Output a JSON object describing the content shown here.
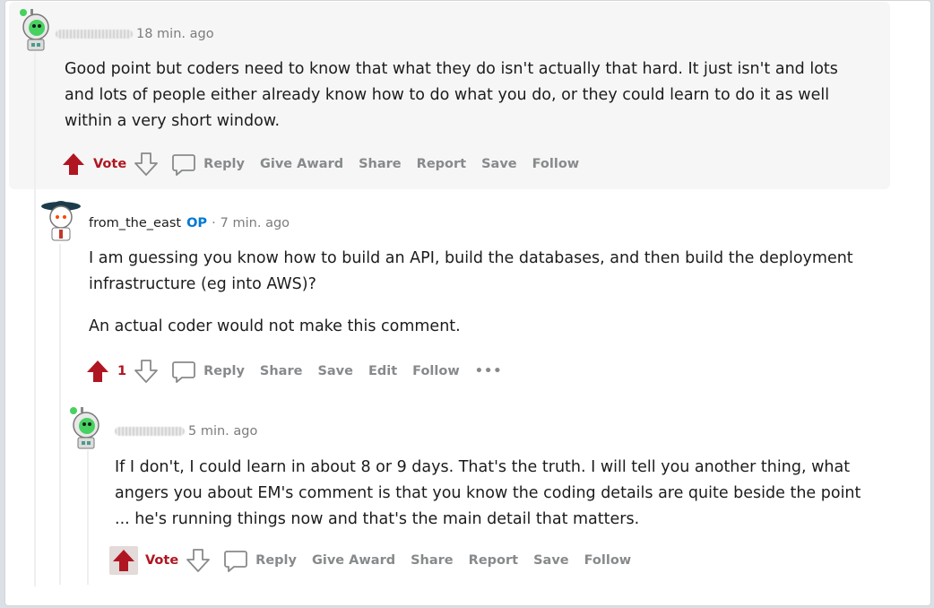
{
  "comments": [
    {
      "time": "18 min. ago",
      "text": [
        "Good point but coders need to know that what they do isn't actually that hard. It just isn't and lots and lots of people either already know how to do what you do, or they could learn to do it as well within a very short window."
      ],
      "vote_label": "Vote",
      "actions": [
        "Reply",
        "Give Award",
        "Share",
        "Report",
        "Save",
        "Follow"
      ]
    },
    {
      "author": "from_the_east",
      "op_badge": "OP",
      "separator": "·",
      "time": "7 min. ago",
      "text": [
        "I am guessing you know how to build an API, build the databases, and then build the deployment infrastructure (eg into AWS)?",
        "An actual coder would not make this comment."
      ],
      "vote_count": "1",
      "actions": [
        "Reply",
        "Share",
        "Save",
        "Edit",
        "Follow"
      ],
      "more": "•••"
    },
    {
      "time": "5 min. ago",
      "text": [
        "If I don't, I could learn in about 8 or 9 days. That's the truth. I will tell you another thing, what angers you about EM's comment is that you know the coding details are quite beside the point ... he's running things now and that's the main detail that matters."
      ],
      "vote_label": "Vote",
      "actions": [
        "Reply",
        "Give Award",
        "Share",
        "Report",
        "Save",
        "Follow"
      ]
    }
  ],
  "colors": {
    "upvote": "#b01621",
    "op": "#0079d3",
    "action_text": "#878a8c",
    "highlight_bg": "#f6f6f6"
  }
}
